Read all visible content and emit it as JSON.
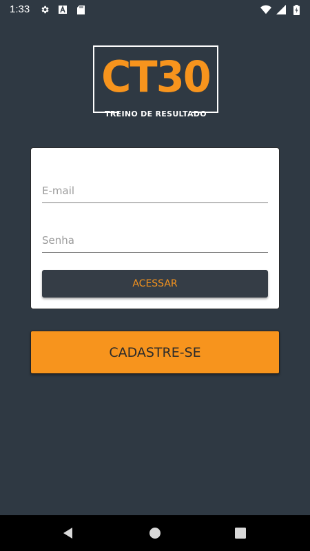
{
  "status_bar": {
    "time": "1:33",
    "left_icons": [
      "gear-icon",
      "font-a-icon",
      "sd-card-icon"
    ],
    "right_icons": [
      "wifi-icon",
      "signal-icon",
      "battery-charging-icon"
    ]
  },
  "logo": {
    "title": "CT30",
    "tagline": "TREINO DE RESULTADO",
    "accent_color": "#f7941d"
  },
  "login_form": {
    "email_placeholder": "E-mail",
    "email_value": "",
    "password_placeholder": "Senha",
    "password_value": "",
    "submit_label": "ACESSAR"
  },
  "signup_button_label": "CADASTRE-SE",
  "nav_bar": {
    "buttons": [
      "back-icon",
      "home-icon",
      "recent-apps-icon"
    ]
  },
  "colors": {
    "background": "#2f3943",
    "accent": "#f7941d",
    "dark_button": "#353d46"
  }
}
